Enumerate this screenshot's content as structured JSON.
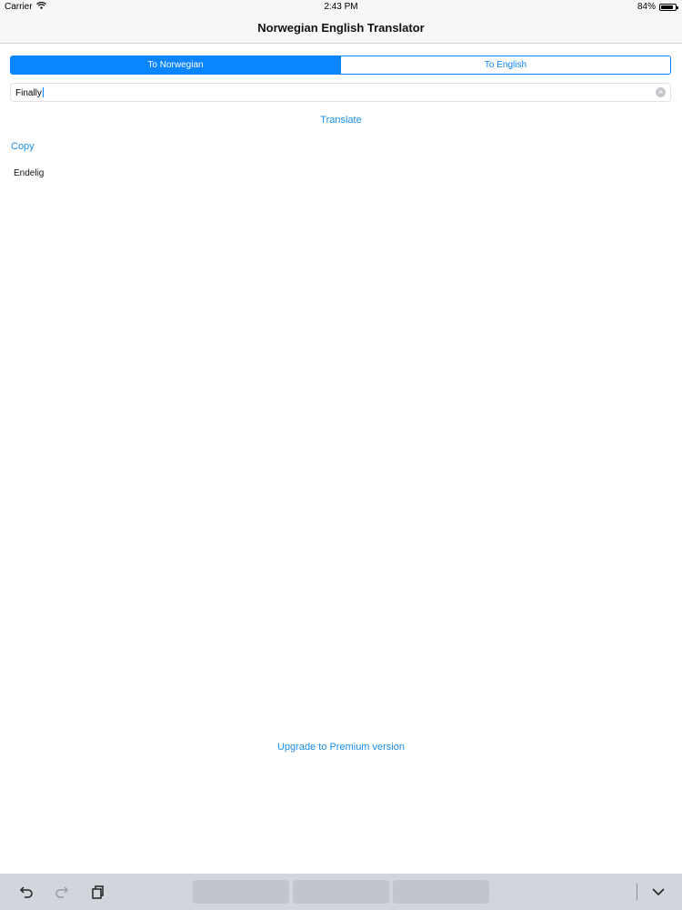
{
  "status_bar": {
    "carrier": "Carrier",
    "time": "2:43 PM",
    "battery": "84%",
    "battery_level": 0.84
  },
  "nav": {
    "title": "Norwegian English Translator"
  },
  "segments": {
    "selected_index": 0,
    "items": [
      "To Norwegian",
      "To English"
    ]
  },
  "input": {
    "value": "Finally"
  },
  "actions": {
    "translate": "Translate",
    "copy": "Copy",
    "upgrade": "Upgrade to Premium version"
  },
  "result": {
    "text": "Endelig"
  },
  "keyboard": {
    "icons": [
      "undo-icon",
      "redo-icon",
      "paste-icon",
      "dismiss-keyboard-icon"
    ]
  },
  "colors": {
    "accent": "#0a84ff",
    "link": "#1a8ee8"
  }
}
